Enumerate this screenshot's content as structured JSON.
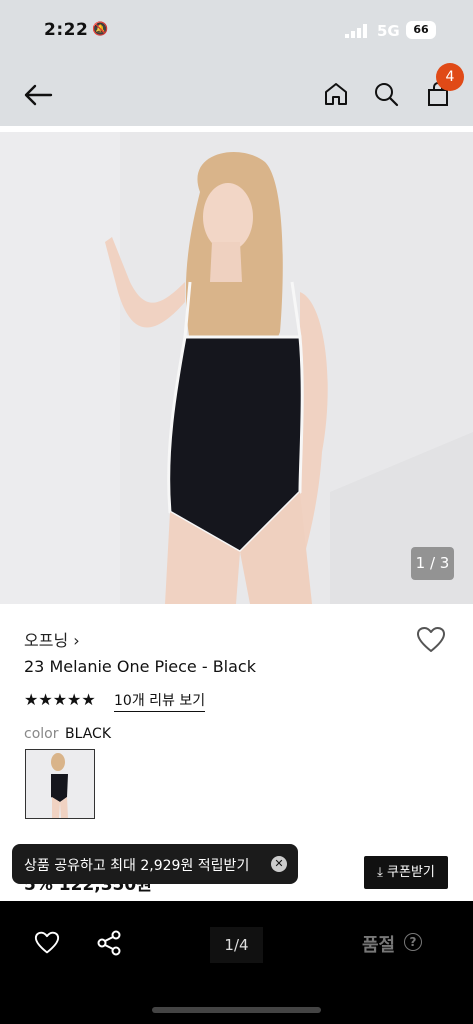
{
  "status": {
    "time": "2:22",
    "network": "5G",
    "battery": "66"
  },
  "header": {
    "back_icon": "back-arrow-icon",
    "home_icon": "home-icon",
    "search_icon": "search-icon",
    "cart_icon": "cart-icon",
    "cart_count": "4"
  },
  "gallery": {
    "counter": "1 / 3"
  },
  "product": {
    "brand": "오프닝 ›",
    "title": "23 Melanie One Piece - Black",
    "stars": "★★★★★",
    "reviews": "10개 리뷰 보기",
    "color_label": "color",
    "color_value": "BLACK",
    "price": "5% 122,350원"
  },
  "toast": {
    "text": "상품 공유하고 최대 2,929원 적립받기",
    "close": "✕"
  },
  "coupon_button": "⤓ 쿠폰받기",
  "bottom_bar": {
    "pager": "1/4",
    "soldout": "품절",
    "help": "?"
  },
  "colors": {
    "badge": "#e04a17",
    "header_bg": "#dcdfe2",
    "bottom_bg": "#000000"
  }
}
